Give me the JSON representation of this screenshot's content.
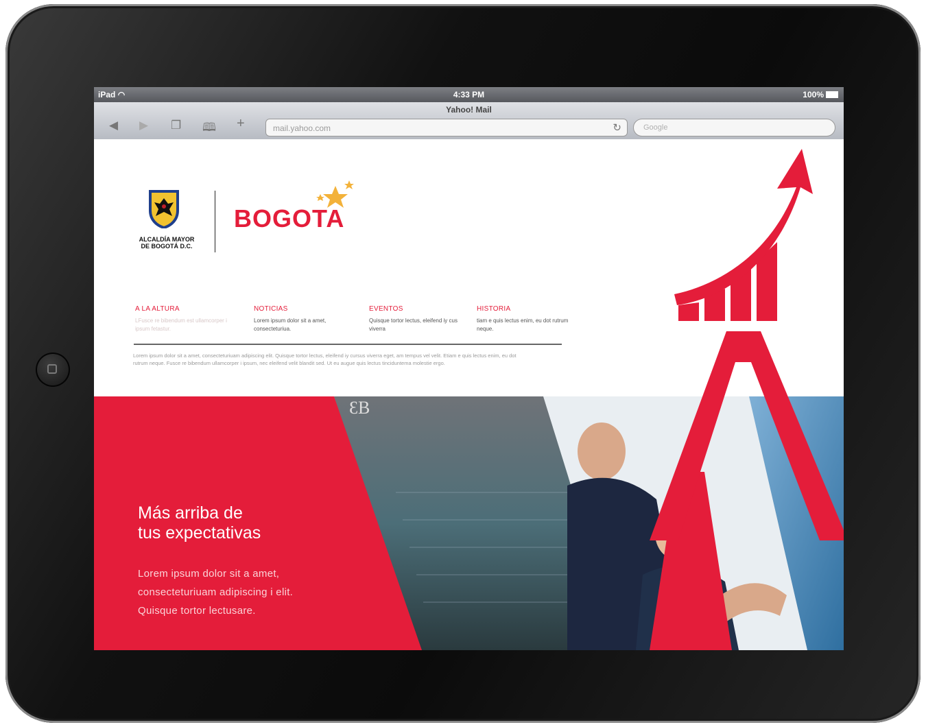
{
  "status_bar": {
    "device": "iPad",
    "time": "4:33 PM",
    "battery": "100%"
  },
  "browser": {
    "page_title": "Yahoo! Mail",
    "url": "mail.yahoo.com",
    "search_placeholder": "Google"
  },
  "logos": {
    "alcaldia_line1": "ALCALDÍA MAYOR",
    "alcaldia_line2": "DE BOGOTÁ D.C.",
    "brand": "BOGOTA"
  },
  "nav": [
    {
      "title": "A LA ALTURA",
      "desc": "LFusce re bibendum est ullamcorper i ipsum fetastur."
    },
    {
      "title": "NOTICIAS",
      "desc": "Lorem ipsum dolor sit a amet, consecteturiua."
    },
    {
      "title": "EVENTOS",
      "desc": "Quisque tortor lectus, eleifend iy cus viverra"
    },
    {
      "title": "HISTORIA",
      "desc": "tiam e quis lectus enim, eu dot rutrum neque."
    }
  ],
  "intro_text": "Lorem ipsum dolor sit a amet, consecteturiuam adipiscing elit. Quisque tortor lectus, eleifend iy cursus viverra eget, am tempus vel velit. Etiam e quis lectus enim, eu dot rutrum neque. Fusce re bibendum ullamcorper i ipsum, nec eleifend velit blandit sed. Ut eu augue quis lectus tinciduntema molestie ergo.",
  "hero": {
    "title_line1": "Más arriba de",
    "title_line2": "tus expectativas",
    "body": "Lorem ipsum dolor sit a amet, consecteturiuam adipiscing i elit. Quisque tortor lectusare.",
    "building_sign": "ƐB"
  },
  "colors": {
    "brand_red": "#e41d3a",
    "star_gold": "#f3b23a"
  },
  "icons": [
    "wifi-icon",
    "battery-icon",
    "back-icon",
    "forward-icon",
    "tabs-icon",
    "bookmarks-icon",
    "add-icon",
    "reload-icon",
    "home-button-icon",
    "coat-of-arms-icon",
    "stars-icon",
    "growth-arrow-icon"
  ]
}
